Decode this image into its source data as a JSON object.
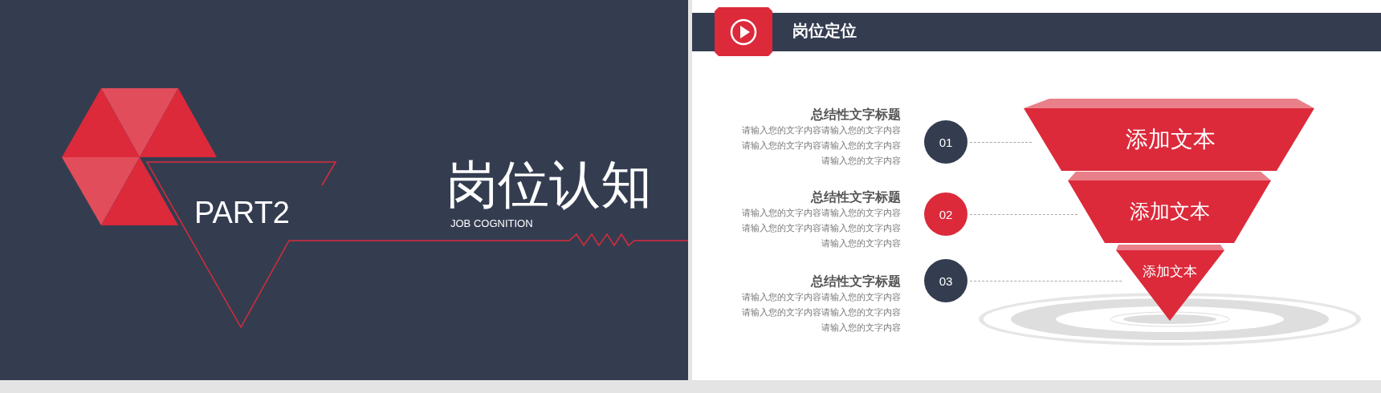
{
  "cover": {
    "part_label": "PART2",
    "title": "岗位认知",
    "subtitle": "JOB COGNITION"
  },
  "content": {
    "header": {
      "title": "岗位定位"
    },
    "items": [
      {
        "number": "01",
        "color": "#343d50",
        "title": "总结性文字标题",
        "lines": [
          "请输入您的文字内容请输入您的文字内容",
          "请输入您的文字内容请输入您的文字内容",
          "请输入您的文字内容"
        ]
      },
      {
        "number": "02",
        "color": "#dc2a3b",
        "title": "总结性文字标题",
        "lines": [
          "请输入您的文字内容请输入您的文字内容",
          "请输入您的文字内容请输入您的文字内容",
          "请输入您的文字内容"
        ]
      },
      {
        "number": "03",
        "color": "#343d50",
        "title": "总结性文字标题",
        "lines": [
          "请输入您的文字内容请输入您的文字内容",
          "请输入您的文字内容请输入您的文字内容",
          "请输入您的文字内容"
        ]
      }
    ],
    "funnel": [
      "添加文本",
      "添加文本",
      "添加文本"
    ]
  }
}
